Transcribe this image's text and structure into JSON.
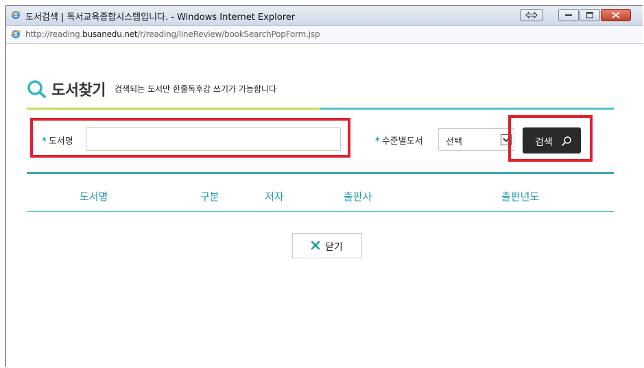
{
  "window": {
    "title": "도서검색 | 독서교육종합시스템입니다. - Windows Internet Explorer",
    "url_prefix": "http://reading.",
    "url_domain": "busanedu.net",
    "url_path": "/r/reading/lineReview/bookSearchPopForm.jsp"
  },
  "heading": {
    "title": "도서찾기",
    "subtitle": "검색되는 도서만 한줄독후감 쓰기가 가능합니다"
  },
  "form": {
    "star": "*",
    "book_label": "도서명",
    "book_value": "",
    "level_label": "수준별도서",
    "level_selected": "선택",
    "search_label": "검색"
  },
  "table": {
    "columns": [
      "도서명",
      "구분",
      "저자",
      "출판사",
      "출판년도"
    ]
  },
  "close_label": "닫기",
  "colors": {
    "accent": "#1d9aa4",
    "highlight": "#e0202d",
    "button_dark": "#2a2a2a"
  }
}
